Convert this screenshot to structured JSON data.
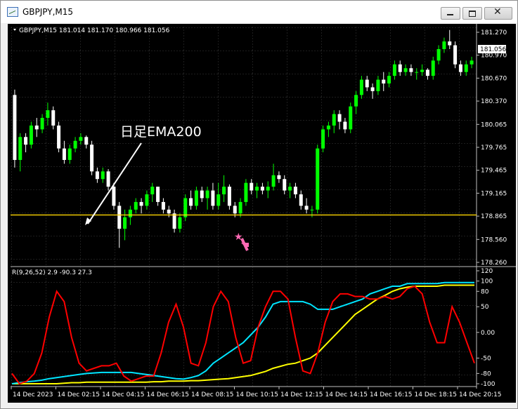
{
  "window": {
    "title": "GBPJPY,M15"
  },
  "main_chart": {
    "header": "GBPJPY,M15  181.014 181.170 180.966 181.056",
    "price_ticks": [
      "181.270",
      "180.970",
      "180.670",
      "180.370",
      "180.065",
      "179.765",
      "179.465",
      "179.165",
      "178.865",
      "178.560",
      "178.260"
    ],
    "current_price": "181.056",
    "annotation": "日足EMA200",
    "ema200_level": 178.88
  },
  "indicator": {
    "header": "R(9,26,52) 2.9 -90.3 27.3",
    "ticks": [
      "120",
      "100",
      "80",
      "50",
      "0.00",
      "-50",
      "-80",
      "-100"
    ]
  },
  "time_axis": [
    "14 Dec 2023",
    "14 Dec 02:15",
    "14 Dec 04:15",
    "14 Dec 06:15",
    "14 Dec 08:15",
    "14 Dec 10:15",
    "14 Dec 12:15",
    "14 Dec 14:15",
    "14 Dec 16:15",
    "14 Dec 18:15",
    "14 Dec 20:15"
  ],
  "colors": {
    "bull": "#00ff00",
    "bear": "#ffffff",
    "ema_line": "#ffd700",
    "red_line": "#ff0000",
    "cyan_line": "#00e5ff",
    "yellow_line": "#ffff00",
    "arrow": "#ff69b4"
  },
  "chart_data": {
    "type": "candlestick",
    "candles": [
      [
        180.45,
        180.52,
        179.5,
        179.6
      ],
      [
        179.6,
        179.95,
        179.45,
        179.9
      ],
      [
        179.9,
        179.95,
        179.7,
        179.8
      ],
      [
        179.8,
        180.1,
        179.75,
        180.05
      ],
      [
        180.05,
        180.15,
        179.9,
        180.0
      ],
      [
        180.0,
        180.2,
        179.95,
        180.15
      ],
      [
        180.15,
        180.35,
        180.05,
        180.25
      ],
      [
        180.25,
        180.3,
        180.0,
        180.05
      ],
      [
        180.05,
        180.1,
        179.7,
        179.75
      ],
      [
        179.75,
        179.85,
        179.55,
        179.6
      ],
      [
        179.6,
        179.8,
        179.55,
        179.75
      ],
      [
        179.75,
        179.9,
        179.7,
        179.85
      ],
      [
        179.85,
        179.95,
        179.8,
        179.9
      ],
      [
        179.9,
        179.92,
        179.75,
        179.8
      ],
      [
        179.8,
        179.85,
        179.4,
        179.45
      ],
      [
        179.45,
        179.5,
        179.3,
        179.35
      ],
      [
        179.35,
        179.5,
        179.3,
        179.45
      ],
      [
        179.45,
        179.48,
        179.2,
        179.25
      ],
      [
        179.25,
        179.3,
        178.95,
        179.0
      ],
      [
        179.0,
        179.05,
        178.45,
        178.7
      ],
      [
        178.7,
        178.95,
        178.55,
        178.85
      ],
      [
        178.85,
        179.0,
        178.75,
        178.95
      ],
      [
        178.95,
        179.1,
        178.9,
        179.05
      ],
      [
        179.05,
        179.1,
        178.9,
        179.0
      ],
      [
        179.0,
        179.2,
        178.95,
        179.15
      ],
      [
        179.15,
        179.3,
        179.05,
        179.25
      ],
      [
        179.25,
        179.25,
        179.0,
        179.05
      ],
      [
        179.05,
        179.1,
        178.9,
        178.95
      ],
      [
        178.95,
        179.0,
        178.85,
        178.9
      ],
      [
        178.9,
        178.95,
        178.65,
        178.7
      ],
      [
        178.7,
        178.9,
        178.65,
        178.85
      ],
      [
        178.85,
        179.15,
        178.8,
        179.1
      ],
      [
        179.1,
        179.2,
        178.95,
        179.0
      ],
      [
        179.0,
        179.25,
        178.95,
        179.2
      ],
      [
        179.2,
        179.25,
        179.05,
        179.1
      ],
      [
        179.1,
        179.25,
        178.95,
        179.2
      ],
      [
        179.2,
        179.3,
        178.95,
        179.0
      ],
      [
        179.0,
        179.3,
        178.95,
        179.15
      ],
      [
        179.15,
        179.4,
        179.05,
        179.25
      ],
      [
        179.25,
        179.28,
        178.95,
        179.0
      ],
      [
        179.0,
        179.05,
        178.85,
        178.9
      ],
      [
        178.9,
        179.1,
        178.85,
        179.05
      ],
      [
        179.05,
        179.35,
        179.0,
        179.3
      ],
      [
        179.3,
        179.35,
        179.15,
        179.2
      ],
      [
        179.2,
        179.3,
        179.1,
        179.25
      ],
      [
        179.25,
        179.3,
        179.15,
        179.2
      ],
      [
        179.2,
        179.32,
        179.1,
        179.25
      ],
      [
        179.25,
        179.55,
        179.2,
        179.4
      ],
      [
        179.4,
        179.45,
        179.3,
        179.35
      ],
      [
        179.35,
        179.4,
        179.15,
        179.2
      ],
      [
        179.2,
        179.3,
        179.1,
        179.25
      ],
      [
        179.25,
        179.3,
        179.1,
        179.15
      ],
      [
        179.15,
        179.2,
        178.95,
        179.0
      ],
      [
        179.0,
        179.1,
        178.9,
        178.95
      ],
      [
        178.95,
        179.0,
        178.85,
        178.95
      ],
      [
        178.95,
        179.8,
        178.9,
        179.75
      ],
      [
        179.75,
        180.05,
        179.7,
        180.0
      ],
      [
        180.0,
        180.1,
        179.9,
        180.05
      ],
      [
        180.05,
        180.25,
        179.95,
        180.2
      ],
      [
        180.2,
        180.25,
        180.0,
        180.1
      ],
      [
        180.1,
        180.15,
        179.95,
        180.0
      ],
      [
        180.0,
        180.35,
        179.95,
        180.3
      ],
      [
        180.3,
        180.5,
        180.2,
        180.45
      ],
      [
        180.45,
        180.7,
        180.4,
        180.65
      ],
      [
        180.65,
        180.7,
        180.5,
        180.55
      ],
      [
        180.55,
        180.6,
        180.4,
        180.5
      ],
      [
        180.5,
        180.7,
        180.45,
        180.65
      ],
      [
        180.65,
        180.75,
        180.5,
        180.6
      ],
      [
        180.6,
        180.75,
        180.55,
        180.7
      ],
      [
        180.7,
        180.9,
        180.65,
        180.85
      ],
      [
        180.85,
        180.9,
        180.7,
        180.75
      ],
      [
        180.75,
        180.85,
        180.7,
        180.8
      ],
      [
        180.8,
        180.85,
        180.7,
        180.75
      ],
      [
        180.75,
        180.8,
        180.65,
        180.75
      ],
      [
        180.75,
        180.85,
        180.7,
        180.78
      ],
      [
        180.78,
        180.8,
        180.65,
        180.7
      ],
      [
        180.7,
        180.95,
        180.65,
        180.9
      ],
      [
        180.9,
        181.1,
        180.85,
        181.05
      ],
      [
        181.05,
        181.2,
        181.0,
        181.15
      ],
      [
        181.15,
        181.3,
        181.05,
        181.1
      ],
      [
        181.1,
        181.15,
        180.8,
        180.85
      ],
      [
        180.85,
        180.9,
        180.7,
        180.75
      ],
      [
        180.75,
        180.9,
        180.7,
        180.85
      ],
      [
        180.85,
        180.95,
        180.8,
        180.9
      ]
    ],
    "ema200": 178.88,
    "oscillator": {
      "ylim": [
        -100,
        120
      ],
      "series": [
        {
          "values": [
            -80,
            -100,
            -95,
            -80,
            -40,
            30,
            80,
            60,
            -10,
            -60,
            -75,
            -70,
            -65,
            -65,
            -60,
            -85,
            -95,
            -90,
            -85,
            -85,
            -40,
            20,
            55,
            10,
            -60,
            -65,
            -20,
            50,
            80,
            60,
            -10,
            -60,
            -55,
            10,
            50,
            80,
            80,
            65,
            -10,
            -75,
            -80,
            -40,
            20,
            60,
            75,
            75,
            70,
            70,
            65,
            65,
            70,
            65,
            70,
            85,
            90,
            75,
            20,
            -20,
            -20,
            50,
            20,
            -20,
            -60
          ]
        },
        {
          "values": [
            -100,
            -98,
            -96,
            -95,
            -93,
            -90,
            -88,
            -86,
            -84,
            -82,
            -80,
            -79,
            -78,
            -78,
            -78,
            -78,
            -78,
            -80,
            -82,
            -84,
            -86,
            -88,
            -90,
            -91,
            -88,
            -84,
            -75,
            -60,
            -50,
            -40,
            -30,
            -20,
            -5,
            10,
            30,
            55,
            60,
            60,
            60,
            60,
            55,
            45,
            45,
            45,
            50,
            55,
            60,
            65,
            75,
            80,
            85,
            90,
            90,
            95,
            95,
            95,
            95,
            95,
            97,
            97,
            97,
            97,
            97
          ]
        },
        {
          "values": [
            -100,
            -100,
            -100,
            -100,
            -100,
            -100,
            -100,
            -99,
            -98,
            -98,
            -97,
            -97,
            -97,
            -97,
            -97,
            -97,
            -97,
            -97,
            -97,
            -96,
            -96,
            -95,
            -95,
            -95,
            -94,
            -94,
            -93,
            -92,
            -91,
            -90,
            -88,
            -86,
            -84,
            -80,
            -76,
            -70,
            -66,
            -62,
            -60,
            -55,
            -50,
            -40,
            -25,
            -10,
            5,
            20,
            35,
            45,
            55,
            65,
            72,
            80,
            85,
            88,
            90,
            90,
            90,
            90,
            92,
            92,
            92,
            92,
            92
          ]
        }
      ]
    }
  }
}
